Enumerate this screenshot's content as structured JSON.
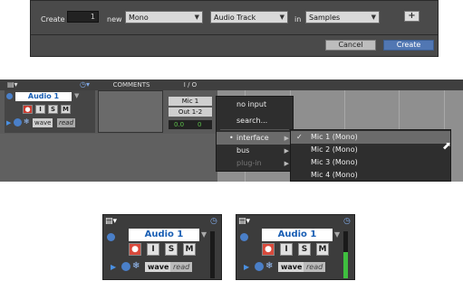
{
  "dialog": {
    "create_label": "Create",
    "count_value": "1",
    "new_label": "new",
    "format_value": "Mono",
    "type_value": "Audio Track",
    "in_label": "in",
    "timebase_value": "Samples",
    "add_row_label": "+",
    "cancel_label": "Cancel",
    "create_button_label": "Create"
  },
  "edit_window": {
    "columns": [
      "COMMENTS",
      "I / O"
    ],
    "track": {
      "name": "Audio 1",
      "buttons": [
        "I",
        "S",
        "M"
      ],
      "view": "wave",
      "automation": "read"
    },
    "io": {
      "input": "Mic 1",
      "output": "Out 1-2",
      "volume_left": "0.0",
      "volume_right": "0"
    }
  },
  "input_menu": {
    "items": [
      {
        "label": "no input",
        "enabled": true
      },
      {
        "label": "search...",
        "enabled": true
      },
      {
        "label": "interface",
        "enabled": true,
        "highlighted": true,
        "has_submenu": true
      },
      {
        "label": "bus",
        "enabled": true,
        "has_submenu": true
      },
      {
        "label": "plug-in",
        "enabled": false,
        "has_submenu": true
      }
    ]
  },
  "interface_submenu": {
    "items": [
      {
        "label": "Mic 1 (Mono)",
        "checked": true,
        "highlighted": true
      },
      {
        "label": "Mic 2 (Mono)",
        "checked": false
      },
      {
        "label": "Mic 3 (Mono)",
        "checked": false
      },
      {
        "label": "Mic 4 (Mono)",
        "checked": false
      }
    ]
  },
  "track_panels": [
    {
      "name": "Audio 1",
      "buttons": [
        "I",
        "S",
        "M"
      ],
      "view": "wave",
      "automation": "read",
      "meter_level": 0.0
    },
    {
      "name": "Audio 1",
      "buttons": [
        "I",
        "S",
        "M"
      ],
      "view": "wave",
      "automation": "read",
      "meter_level": 0.55
    }
  ],
  "colors": {
    "accent_blue": "#5177b3",
    "track_name_blue": "#1a5fb4",
    "record_red": "#d84a3c",
    "meter_green": "#3fbf3f",
    "menu_highlight": "#6b6b6b"
  }
}
